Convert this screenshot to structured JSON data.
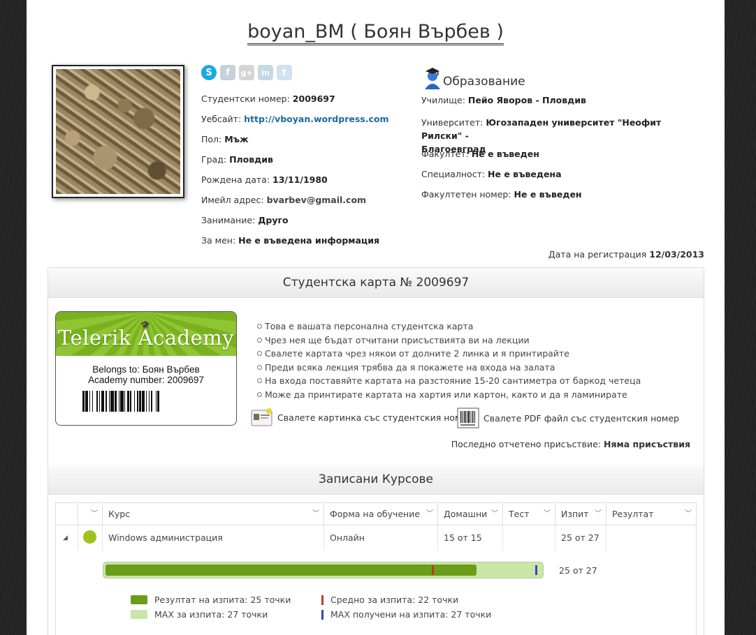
{
  "profile": {
    "title": "boyan_BM ( Боян Върбев )",
    "fields": [
      {
        "label": "Студентски номер:",
        "value": "2009697"
      },
      {
        "label": "Уебсайт:",
        "value": "http://vboyan.wordpress.com"
      },
      {
        "label": "Пол:",
        "value": "Мъж"
      },
      {
        "label": "Град:",
        "value": "Пловдив"
      },
      {
        "label": "Рождена дата:",
        "value": "13/11/1980"
      },
      {
        "label": "Имейл адрес:",
        "value": "bvarbev@gmail.com"
      },
      {
        "label": "Занимание:",
        "value": "Друго"
      },
      {
        "label": "За мен:",
        "value": "Не е въведена информация"
      }
    ],
    "social": {
      "skype": {
        "glyph": "S",
        "color": "#19a9e5"
      },
      "facebook": {
        "glyph": "f",
        "color": "#c7d0dc"
      },
      "googleplus": {
        "glyph": "g+",
        "color": "#d5d5d5"
      },
      "linkedin": {
        "glyph": "in",
        "color": "#c6d8e3"
      },
      "twitter": {
        "glyph": "t",
        "color": "#cfe2ef"
      }
    }
  },
  "education": {
    "heading": "Образование",
    "school_label": "Училище:",
    "school": "Пейо Яворов - Пловдив",
    "university_label": "Университет:",
    "university_line1": "Югозападен университет \"Неофит Рилски\" -",
    "university_line2": "Благоевград",
    "faculty_label": "Факултет:",
    "faculty": "Не е въведен",
    "specialty_label": "Специалност:",
    "specialty": "Не е въведена",
    "faculty_number_label": "Факултетен номер:",
    "faculty_number": "Не е въведен"
  },
  "registration": {
    "label": "Дата на регистрация",
    "date": "12/03/2013"
  },
  "student_card": {
    "heading": "Студентска карта № 2009697",
    "card_brand": "Telerik Academy",
    "belongs_to": "Belongs to: Боян Върбев",
    "academy_number": "Academy number: 2009697",
    "bullets": [
      "Това е вашата персонална студентска карта",
      "Чрез нея ще бъдат отчитани присъствията ви на лекции",
      "Свалете картата чрез някои от долните 2 линка и я принтирайте",
      "Преди всяка лекция трябва да я покажете на входа на залата",
      "На входа поставяйте картата на разстояние 15-20 сантиметра от баркод четеца",
      "Може да принтирате картата на хартия или картон, както и да я ламинирате"
    ],
    "download_image": "Свалете картинка със студентския номер",
    "download_pdf": "Свалете PDF файл със студентския номер",
    "last_attendance_label": "Последно отчетено присъствие:",
    "last_attendance": "Няма присъствия"
  },
  "courses": {
    "heading": "Записани Курсове",
    "columns": [
      "Курс",
      "Форма на обучение",
      "Домашни",
      "Тест",
      "Изпит",
      "Резултат"
    ],
    "rows": [
      {
        "course": "Windows администрация",
        "form": "Онлайн",
        "homework": "15 от 15",
        "test": "",
        "exam": "25 от 27",
        "result": "",
        "status_color": "#9cc41a"
      }
    ],
    "progress": {
      "label": "25 от 27",
      "result": 25,
      "max": 27,
      "average": 22,
      "max_received": 27,
      "colors": {
        "result": "#6b9d19",
        "max": "#c9e6a6",
        "average": "#c0392b",
        "max_received": "#3247b8"
      }
    },
    "legend": {
      "result": "Резултат на изпита: 25 точки",
      "max": "MAX за изпита: 27 точки",
      "average": "Средно за изпита: 22 точки",
      "max_received": "MAX получени на изпита: 27 точки"
    }
  }
}
